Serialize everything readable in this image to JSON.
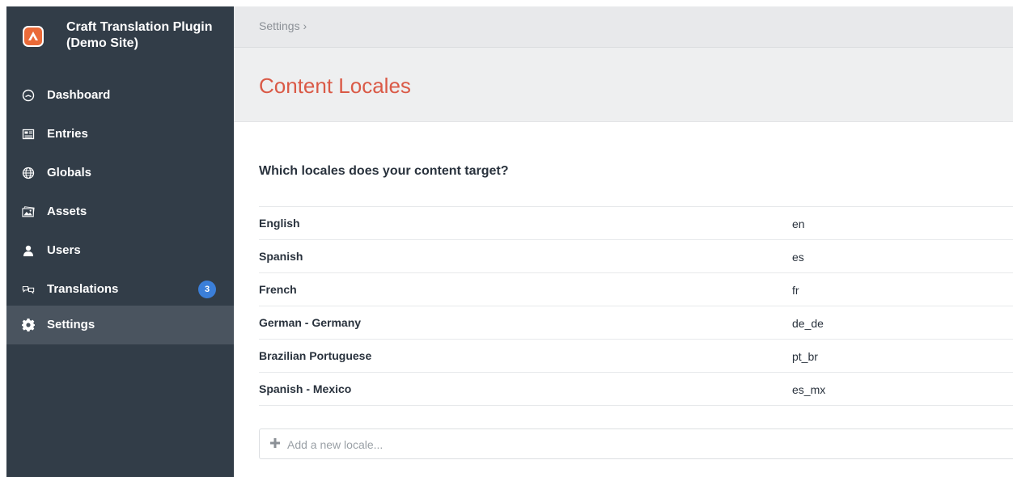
{
  "colors": {
    "sidebar": "#323d48",
    "active_item": "#4a545f",
    "accent_title": "#da5a47",
    "badge": "#3b7fd9"
  },
  "site": {
    "name": "Craft Translation Plugin (Demo Site)",
    "logo_icon": "craft-logo-icon"
  },
  "sidebar": {
    "items": [
      {
        "label": "Dashboard",
        "icon": "dashboard-gauge-icon"
      },
      {
        "label": "Entries",
        "icon": "entries-icon"
      },
      {
        "label": "Globals",
        "icon": "globe-icon"
      },
      {
        "label": "Assets",
        "icon": "assets-image-icon"
      },
      {
        "label": "Users",
        "icon": "user-icon"
      },
      {
        "label": "Translations",
        "icon": "translations-icon",
        "badge": "3"
      },
      {
        "label": "Settings",
        "icon": "gear-icon",
        "active": true
      }
    ]
  },
  "breadcrumb": {
    "text": "Settings ›"
  },
  "page": {
    "title": "Content Locales",
    "question": "Which locales does your content target?"
  },
  "locales": [
    {
      "name": "English",
      "code": "en"
    },
    {
      "name": "Spanish",
      "code": "es"
    },
    {
      "name": "French",
      "code": "fr"
    },
    {
      "name": "German - Germany",
      "code": "de_de"
    },
    {
      "name": "Brazilian Portuguese",
      "code": "pt_br"
    },
    {
      "name": "Spanish - Mexico",
      "code": "es_mx"
    }
  ],
  "add_locale": {
    "placeholder": "Add a new locale...",
    "value": ""
  }
}
